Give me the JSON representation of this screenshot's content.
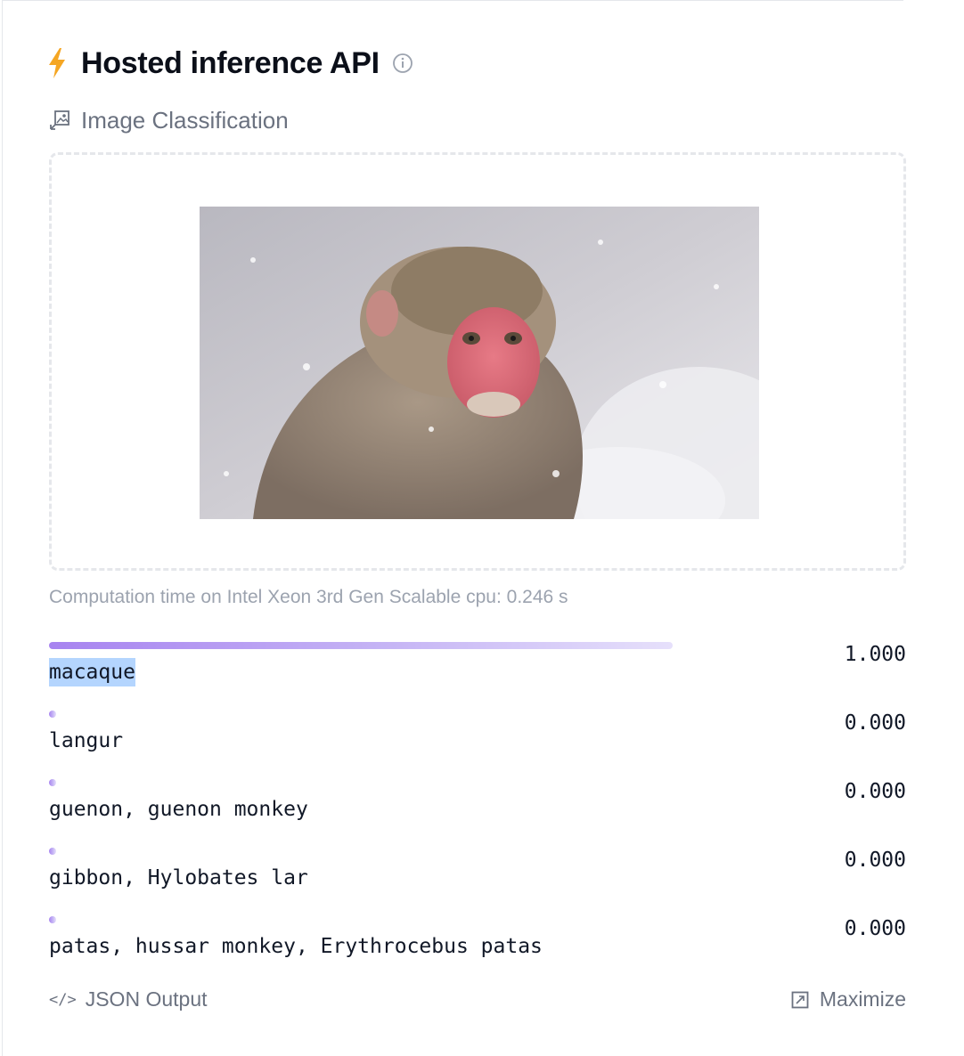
{
  "widget": {
    "title": "Hosted inference API",
    "task": "Image Classification",
    "computation_time": "Computation time on Intel Xeon 3rd Gen Scalable cpu: 0.246 s",
    "json_output_label": "JSON Output",
    "maximize_label": "Maximize",
    "icons": {
      "title": "lightning-bolt-icon",
      "info": "info-icon",
      "task": "image-classification-icon",
      "json": "code-icon",
      "maximize": "maximize-icon"
    },
    "colors": {
      "bolt": "#f5a623",
      "bar_start": "#a783f0",
      "selection": "#b4d5fe"
    }
  },
  "results": [
    {
      "label": "macaque",
      "score": "1.000",
      "value": 1.0,
      "selected": true
    },
    {
      "label": "langur",
      "score": "0.000",
      "value": 0.0,
      "selected": false
    },
    {
      "label": "guenon, guenon monkey",
      "score": "0.000",
      "value": 0.0,
      "selected": false
    },
    {
      "label": "gibbon, Hylobates lar",
      "score": "0.000",
      "value": 0.0,
      "selected": false
    },
    {
      "label": "patas, hussar monkey, Erythrocebus patas",
      "score": "0.000",
      "value": 0.0,
      "selected": false
    }
  ]
}
